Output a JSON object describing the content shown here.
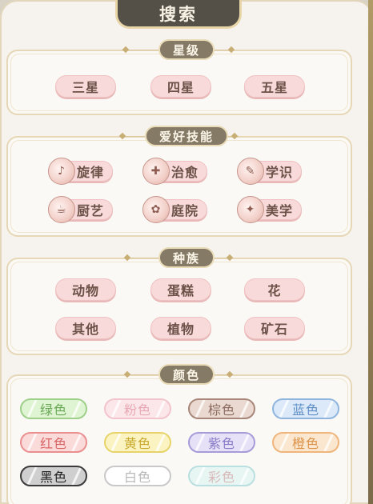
{
  "title": "搜索",
  "sections": {
    "rarity": {
      "header": "星级",
      "items": [
        "三星",
        "四星",
        "五星"
      ]
    },
    "hobby": {
      "header": "爱好技能",
      "items": [
        {
          "label": "旋律",
          "icon": "music-icon"
        },
        {
          "label": "治愈",
          "icon": "heal-icon"
        },
        {
          "label": "学识",
          "icon": "book-icon"
        },
        {
          "label": "厨艺",
          "icon": "cooking-icon"
        },
        {
          "label": "庭院",
          "icon": "garden-icon"
        },
        {
          "label": "美学",
          "icon": "art-icon"
        }
      ]
    },
    "species": {
      "header": "种族",
      "items": [
        "动物",
        "蛋糕",
        "花",
        "其他",
        "植物",
        "矿石"
      ]
    },
    "color": {
      "header": "颜色",
      "items": [
        {
          "label": "绿色",
          "fill": "#dff4d2",
          "border": "#9fd08a",
          "text": "#6aa856"
        },
        {
          "label": "粉色",
          "fill": "#fbe6e9",
          "border": "#f2c4cc",
          "text": "#e8a9b4"
        },
        {
          "label": "棕色",
          "fill": "#ead9d0",
          "border": "#a8877a",
          "text": "#8c6c60"
        },
        {
          "label": "蓝色",
          "fill": "#dbe9f8",
          "border": "#8fb5df",
          "text": "#5f8fc6"
        },
        {
          "label": "红色",
          "fill": "#fbdada",
          "border": "#ea8f8f",
          "text": "#d96464"
        },
        {
          "label": "黄色",
          "fill": "#fbf4c2",
          "border": "#e7d36a",
          "text": "#c9a92e"
        },
        {
          "label": "紫色",
          "fill": "#e6e1f6",
          "border": "#a99ad8",
          "text": "#8b7ac8"
        },
        {
          "label": "橙色",
          "fill": "#fbe6cf",
          "border": "#efb57a",
          "text": "#dd9449"
        },
        {
          "label": "黑色",
          "fill": "#cfcfcf",
          "border": "#3a3a3a",
          "text": "#222222"
        },
        {
          "label": "白色",
          "fill": "#ffffff",
          "border": "#c9c9c9",
          "text": "#b8b8b8"
        },
        {
          "label": "彩色",
          "fill": "#e7f6f3",
          "border": "#b9dfe0",
          "text": "#d8b8b8"
        }
      ]
    }
  }
}
